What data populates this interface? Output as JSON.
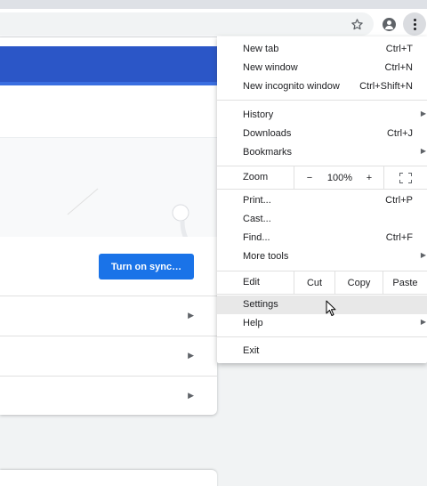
{
  "toolbar": {
    "icons": [
      "star-icon",
      "profile-icon",
      "more-vert-icon"
    ]
  },
  "page": {
    "sync_button": "Turn on sync…"
  },
  "menu": {
    "items": [
      {
        "label": "New tab",
        "shortcut": "Ctrl+T"
      },
      {
        "label": "New window",
        "shortcut": "Ctrl+N"
      },
      {
        "label": "New incognito window",
        "shortcut": "Ctrl+Shift+N"
      },
      {
        "label": "History",
        "submenu": true
      },
      {
        "label": "Downloads",
        "shortcut": "Ctrl+J"
      },
      {
        "label": "Bookmarks",
        "submenu": true
      },
      {
        "label": "Print...",
        "shortcut": "Ctrl+P"
      },
      {
        "label": "Cast..."
      },
      {
        "label": "Find...",
        "shortcut": "Ctrl+F"
      },
      {
        "label": "More tools",
        "submenu": true
      },
      {
        "label": "Settings",
        "highlighted": true
      },
      {
        "label": "Help",
        "submenu": true
      },
      {
        "label": "Exit"
      }
    ],
    "zoom": {
      "label": "Zoom",
      "minus": "−",
      "value": "100%",
      "plus": "+"
    },
    "edit": {
      "label": "Edit",
      "cut": "Cut",
      "copy": "Copy",
      "paste": "Paste"
    }
  },
  "colors": {
    "accent": "#1a73e8",
    "header_blue": "#2b56c7",
    "highlight": "#e8e8e8"
  }
}
